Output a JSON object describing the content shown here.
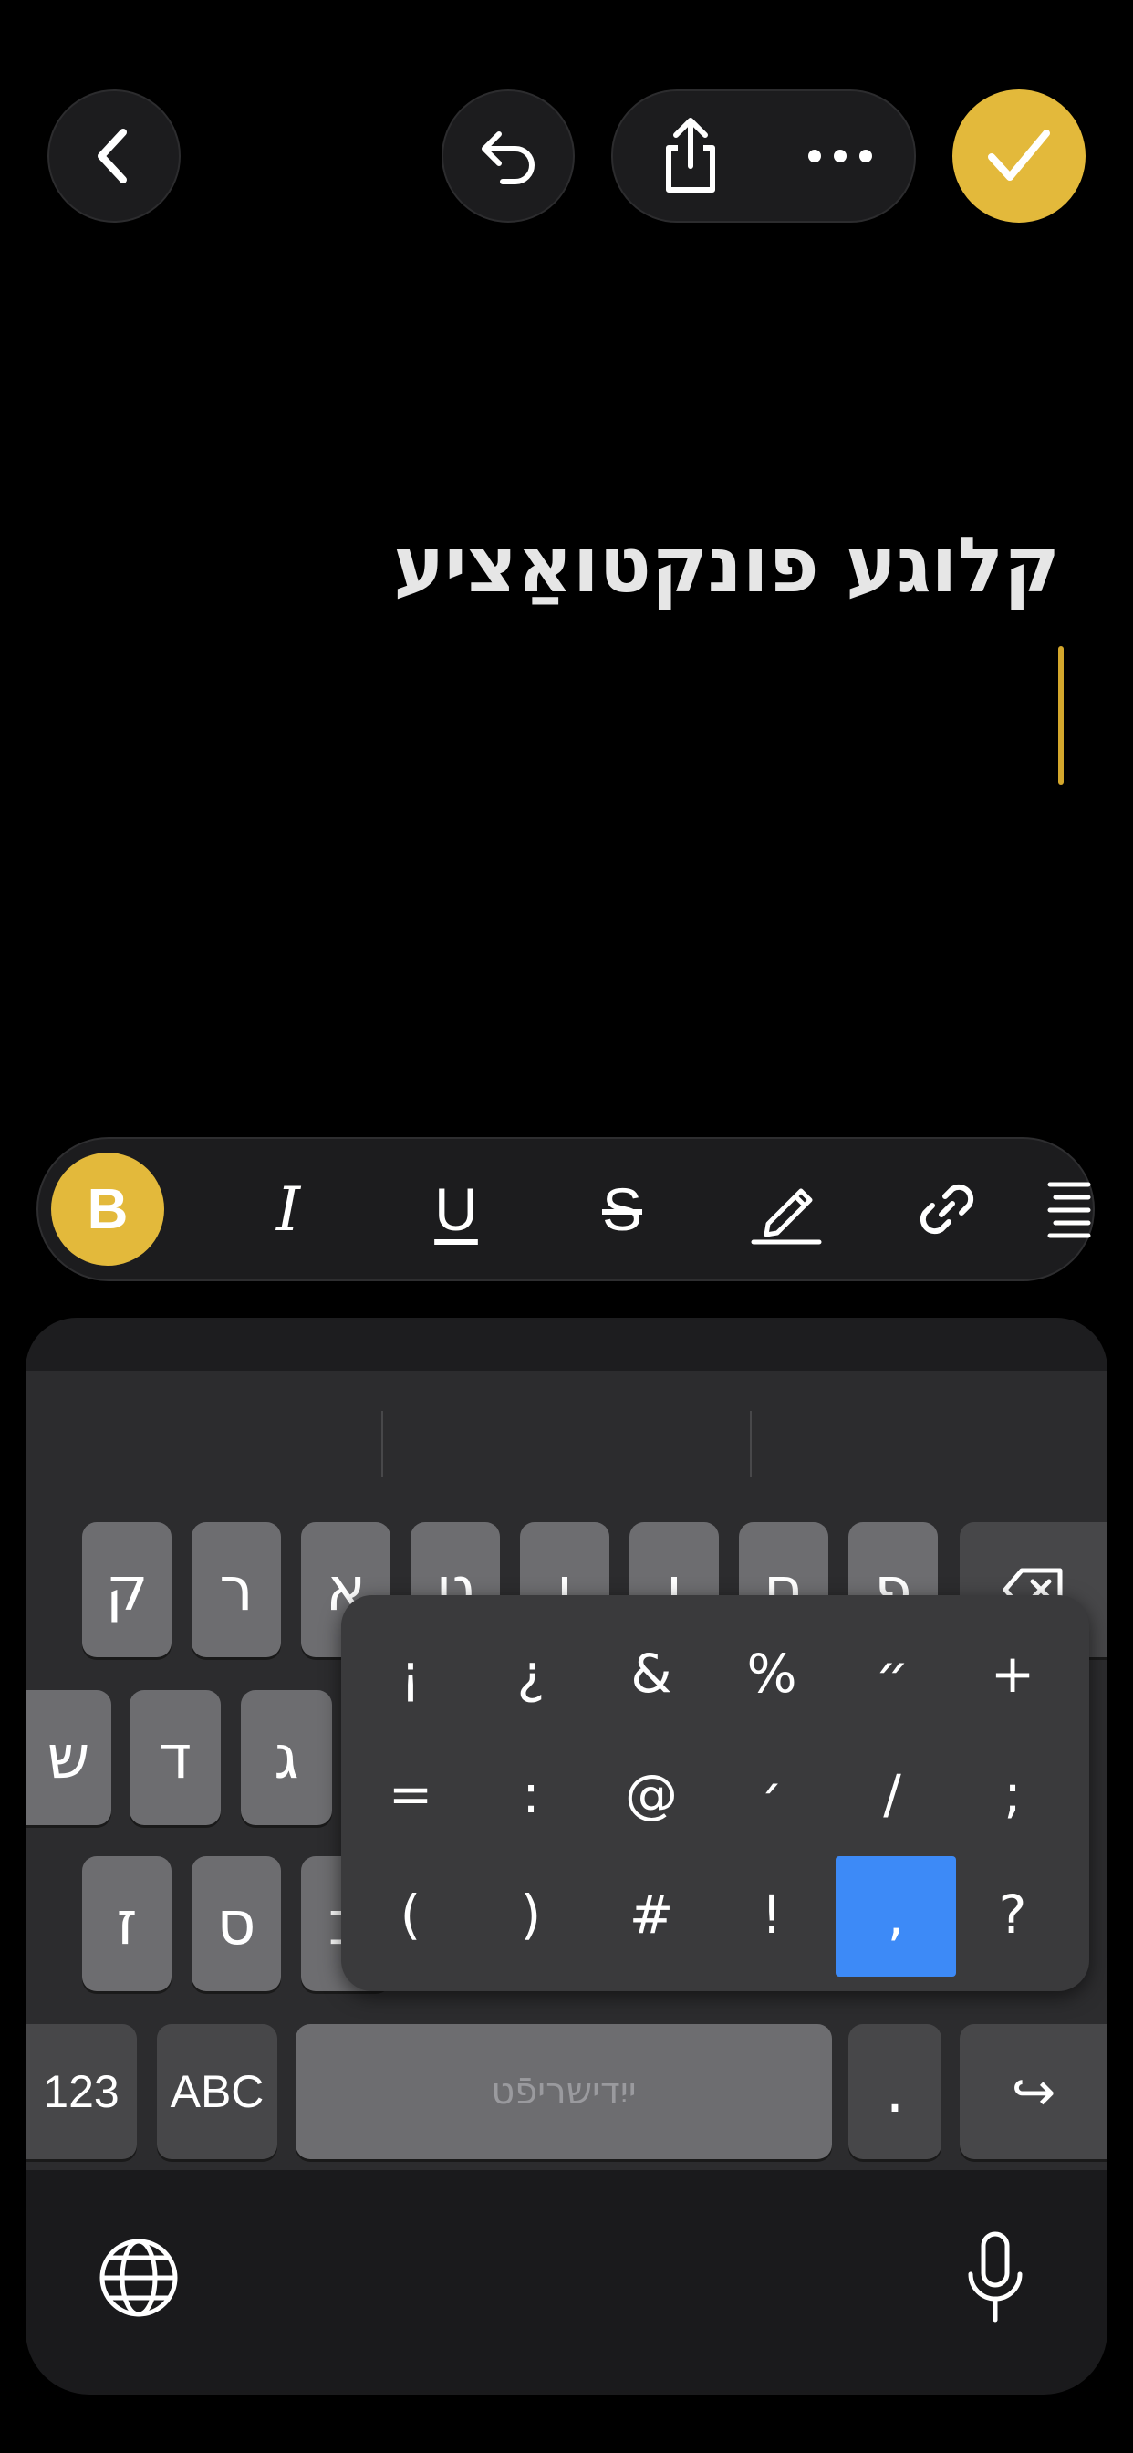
{
  "toolbar": {
    "back_icon": "chevron-left-icon",
    "undo_icon": "undo-icon",
    "share_icon": "share-icon",
    "more_icon": "ellipsis-icon",
    "done_icon": "checkmark-icon",
    "done_color": "#e3b93b"
  },
  "note": {
    "title": "קלוגע פונקטואַציע",
    "cursor_color": "#d4a72c"
  },
  "format_bar": {
    "bold": "B",
    "italic": "I",
    "underline": "U",
    "strike": "S",
    "highlight_icon": "pencil-highlight-icon",
    "link_icon": "link-icon",
    "align_icon": "text-align-icon",
    "active_color": "#e3b93b"
  },
  "keyboard": {
    "row1": [
      "ק",
      "ר",
      "א",
      "ט",
      "ו",
      "ן",
      "ם",
      "פ"
    ],
    "row2": [
      "ש",
      "ד",
      "ג"
    ],
    "row3": [
      "ז",
      "ס",
      "ב"
    ],
    "numbers_label": "123",
    "abc_label": "ABC",
    "space_label": "ייִדישריפֿט",
    "period_label": ".",
    "return_label": "↪",
    "globe_icon": "globe-icon",
    "mic_icon": "microphone-icon",
    "delete_icon": "delete-icon"
  },
  "punctuation_popup": {
    "row1": [
      "¡",
      "¿",
      "&",
      "%",
      "״",
      "+"
    ],
    "row2": [
      "=",
      ":",
      "@",
      "׳",
      "/",
      ";"
    ],
    "row3": [
      "(",
      ")",
      "#",
      "!",
      ",",
      "?"
    ],
    "selected": ",",
    "selected_color": "#3d8af7"
  }
}
